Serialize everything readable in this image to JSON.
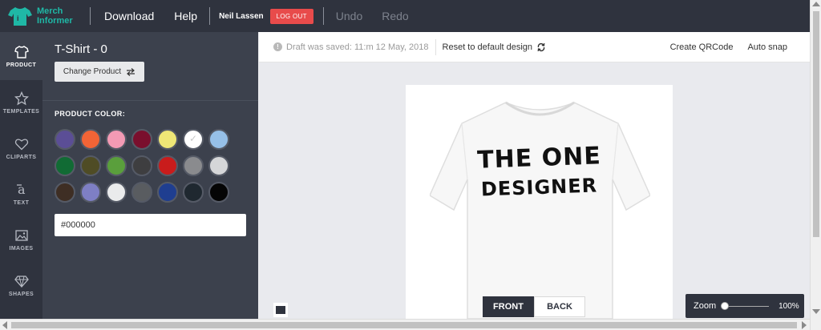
{
  "header": {
    "logo_line1": "Merch",
    "logo_line2": "Informer",
    "download": "Download",
    "help": "Help",
    "user_name": "Neil Lassen",
    "logout": "LOG OUT",
    "undo": "Undo",
    "redo": "Redo"
  },
  "rail": {
    "product": "PRODUCT",
    "templates": "TEMPLATES",
    "cliparts": "CLIPARTS",
    "text": "TEXT",
    "images": "IMAGES",
    "shapes": "SHAPES"
  },
  "panel": {
    "title": "T-Shirt - 0",
    "change_product": "Change Product",
    "color_heading": "PRODUCT COLOR:",
    "hex_value": "#000000",
    "colors": [
      "#5b4e96",
      "#f26436",
      "#f39ab4",
      "#7a0f2d",
      "#efe776",
      "#ffffff",
      "#96c0e8",
      "#116b34",
      "#4f4c25",
      "#5a9f3c",
      "#3e3e40",
      "#c91c1c",
      "#8a8b8e",
      "#d5d6d8",
      "#3e2e24",
      "#7e7fc4",
      "#eaebec",
      "#595c60",
      "#1f3e90",
      "#1f2830",
      "#050505"
    ],
    "selected_color": "#ffffff"
  },
  "toolbar": {
    "draft": "Draft was saved: 11:m 12 May, 2018",
    "reset": "Reset to default design",
    "qrcode": "Create QRCode",
    "autosnap": "Auto snap"
  },
  "design": {
    "line1": "THE ONE",
    "line2": "DESIGNER",
    "front": "FRONT",
    "back": "BACK"
  },
  "zoom": {
    "label": "Zoom",
    "value": "100%"
  }
}
